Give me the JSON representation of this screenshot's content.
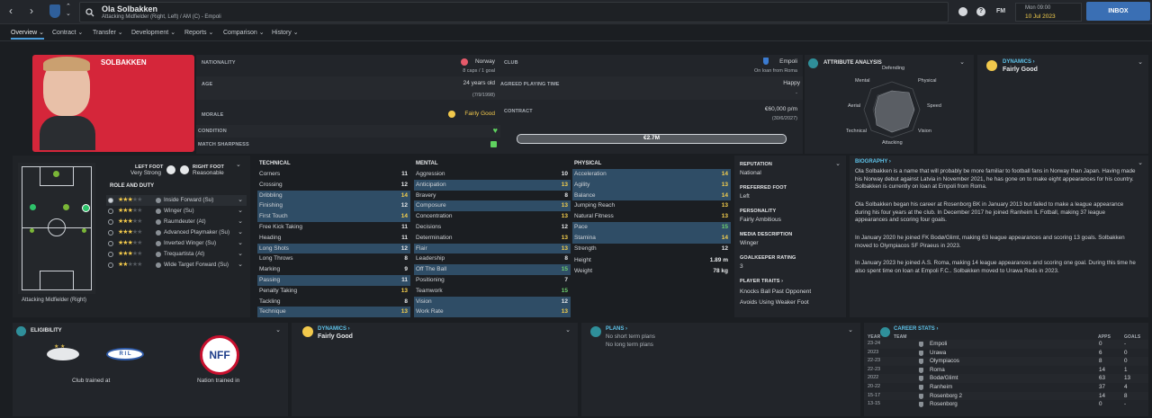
{
  "topbar": {
    "player_name": "Ola Solbakken",
    "player_sub": "Attacking Midfielder (Right, Left) / AM (C) - Empoli",
    "fm_label": "FM",
    "day_time": "Mon 09:00",
    "date": "10 Jul 2023",
    "inbox_label": "INBOX"
  },
  "tabs": [
    {
      "label": "Overview"
    },
    {
      "label": "Contract"
    },
    {
      "label": "Transfer"
    },
    {
      "label": "Development"
    },
    {
      "label": "Reports"
    },
    {
      "label": "Comparison"
    },
    {
      "label": "History"
    }
  ],
  "profile": {
    "surname": "SOLBAKKEN",
    "nationality_label": "NATIONALITY",
    "nationality": "Norway",
    "caps": "8 caps / 1 goal",
    "age_label": "AGE",
    "age": "24 years old",
    "dob": "(7/9/1998)",
    "morale_label": "MORALE",
    "morale": "Fairly Good",
    "condition_label": "CONDITION",
    "sharpness_label": "MATCH SHARPNESS",
    "club_label": "CLUB",
    "club": "Empoli",
    "club_sub": "On loan from Roma",
    "apt_label": "AGREED PLAYING TIME",
    "apt": "Happy",
    "apt_sub": "-",
    "contract_label": "CONTRACT",
    "wage": "€60,000 p/m",
    "contract_end": "(30/6/2027)",
    "value": "€2.7M"
  },
  "attr_analysis": {
    "title": "ATTRIBUTE ANALYSIS",
    "labels": [
      "Defending",
      "Physical",
      "Speed",
      "Vision",
      "Attacking",
      "Technical",
      "Aerial",
      "Mental"
    ]
  },
  "dynamics_top": {
    "title": "DYNAMICS",
    "value": "Fairly Good"
  },
  "feet": {
    "left_label": "LEFT FOOT",
    "left": "Very Strong",
    "right_label": "RIGHT FOOT",
    "right": "Reasonable"
  },
  "roles": {
    "title": "ROLE AND DUTY",
    "position": "Attacking Midfielder (Right)",
    "items": [
      {
        "name": "Inside Forward (Su)",
        "stars": 3
      },
      {
        "name": "Winger (Su)",
        "stars": 3
      },
      {
        "name": "Raumdeuter (At)",
        "stars": 3
      },
      {
        "name": "Advanced Playmaker (Su)",
        "stars": 3
      },
      {
        "name": "Inverted Winger (Su)",
        "stars": 3
      },
      {
        "name": "Trequartista (At)",
        "stars": 2.5
      },
      {
        "name": "Wide Target Forward (Su)",
        "stars": 2
      }
    ]
  },
  "technical": {
    "title": "TECHNICAL",
    "items": [
      {
        "n": "Corners",
        "v": "11"
      },
      {
        "n": "Crossing",
        "v": "12"
      },
      {
        "n": "Dribbling",
        "v": "14",
        "h": true
      },
      {
        "n": "Finishing",
        "v": "12",
        "h": true
      },
      {
        "n": "First Touch",
        "v": "14",
        "h": true
      },
      {
        "n": "Free Kick Taking",
        "v": "11"
      },
      {
        "n": "Heading",
        "v": "11"
      },
      {
        "n": "Long Shots",
        "v": "12",
        "h": true
      },
      {
        "n": "Long Throws",
        "v": "8"
      },
      {
        "n": "Marking",
        "v": "9"
      },
      {
        "n": "Passing",
        "v": "11",
        "h": true
      },
      {
        "n": "Penalty Taking",
        "v": "13"
      },
      {
        "n": "Tackling",
        "v": "8"
      },
      {
        "n": "Technique",
        "v": "13",
        "h": true
      }
    ]
  },
  "mental": {
    "title": "MENTAL",
    "items": [
      {
        "n": "Aggression",
        "v": "10"
      },
      {
        "n": "Anticipation",
        "v": "13",
        "h": true
      },
      {
        "n": "Bravery",
        "v": "8"
      },
      {
        "n": "Composure",
        "v": "13",
        "h": true
      },
      {
        "n": "Concentration",
        "v": "13"
      },
      {
        "n": "Decisions",
        "v": "12"
      },
      {
        "n": "Determination",
        "v": "13"
      },
      {
        "n": "Flair",
        "v": "13",
        "h": true
      },
      {
        "n": "Leadership",
        "v": "8"
      },
      {
        "n": "Off The Ball",
        "v": "15",
        "h": true
      },
      {
        "n": "Positioning",
        "v": "7"
      },
      {
        "n": "Teamwork",
        "v": "15"
      },
      {
        "n": "Vision",
        "v": "12",
        "h": true
      },
      {
        "n": "Work Rate",
        "v": "13",
        "h": true
      }
    ]
  },
  "physical": {
    "title": "PHYSICAL",
    "items": [
      {
        "n": "Acceleration",
        "v": "14",
        "h": true
      },
      {
        "n": "Agility",
        "v": "13",
        "h": true
      },
      {
        "n": "Balance",
        "v": "14",
        "h": true
      },
      {
        "n": "Jumping Reach",
        "v": "13"
      },
      {
        "n": "Natural Fitness",
        "v": "13"
      },
      {
        "n": "Pace",
        "v": "15",
        "h": true
      },
      {
        "n": "Stamina",
        "v": "14",
        "h": true
      },
      {
        "n": "Strength",
        "v": "12"
      }
    ],
    "height_label": "Height",
    "height": "1.89 m",
    "weight_label": "Weight",
    "weight": "78 kg"
  },
  "info": {
    "rep_label": "REPUTATION",
    "rep": "National",
    "foot_label": "PREFERRED FOOT",
    "foot": "Left",
    "pers_label": "PERSONALITY",
    "pers": "Fairly Ambitious",
    "media_label": "MEDIA DESCRIPTION",
    "media": "Winger",
    "gk_label": "GOALKEEPER RATING",
    "gk": "3",
    "traits_label": "PLAYER TRAITS",
    "traits": [
      "Knocks Ball Past Opponent",
      "Avoids Using Weaker Foot"
    ]
  },
  "biography": {
    "title": "BIOGRAPHY",
    "paras": [
      "Ola Solbakken is a name that will probably be more familiar to football fans in Norway than Japan. Having made his Norway debut against Latvia in November 2021, he has gone on to make eight appearances for his country. Solbakken is currently on loan at Empoli from Roma.",
      "Ola Solbakken began his career at Rosenborg BK in January 2013 but failed to make a league appearance during his four years at the club. In December 2017 he joined Ranheim IL Fotball, making 37 league appearances and scoring four goals.",
      "In January 2020 he joined FK Bodø/Glimt, making 63 league appearances and scoring 13 goals. Solbakken moved to Olympiacos SF Piraeus in 2023.",
      "In January 2023 he joined A.S. Roma, making 14 league appearances and scoring one goal. During this time he also spent time on loan at Empoli F.C.. Solbakken moved to Urawa Reds in 2023."
    ]
  },
  "eligibility": {
    "title": "ELIGIBILITY",
    "club_trained": "Club trained at",
    "nation_trained": "Nation trained in",
    "club_logo": "R I L",
    "nation_logo": "NFF"
  },
  "dynamics_bottom": {
    "title": "DYNAMICS",
    "value": "Fairly Good"
  },
  "plans": {
    "title": "PLANS",
    "short": "No short term plans",
    "long": "No long term plans"
  },
  "career": {
    "title": "CAREER STATS",
    "year": "YEAR",
    "team": "TEAM",
    "apps": "APPS",
    "goals": "GOALS",
    "rows": [
      {
        "y": "23-24",
        "t": "Empoli",
        "a": "0",
        "g": "-"
      },
      {
        "y": "2023",
        "t": "Urawa",
        "a": "6",
        "g": "0"
      },
      {
        "y": "22-23",
        "t": "Olympiacos",
        "a": "8",
        "g": "0"
      },
      {
        "y": "22-23",
        "t": "Roma",
        "a": "14",
        "g": "1"
      },
      {
        "y": "2022",
        "t": "Bodø/Glimt",
        "a": "63",
        "g": "13"
      },
      {
        "y": "20-22",
        "t": "Ranheim",
        "a": "37",
        "g": "4"
      },
      {
        "y": "15-17",
        "t": "Rosenborg 2",
        "a": "14",
        "g": "8"
      },
      {
        "y": "13-15",
        "t": "Rosenborg",
        "a": "0",
        "g": "-"
      }
    ]
  }
}
